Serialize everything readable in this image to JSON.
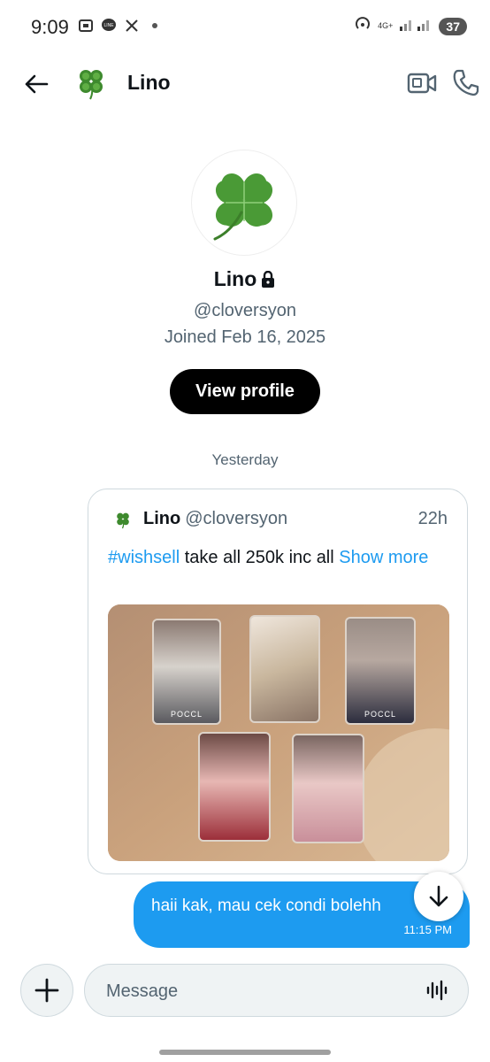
{
  "status_bar": {
    "time": "9:09",
    "network_label": "4G+",
    "battery": "37",
    "left_icons": [
      "screenshot-icon",
      "line-app-icon",
      "x-app-icon",
      "dot-icon"
    ]
  },
  "header": {
    "title": "Lino",
    "icons": [
      "back-arrow-icon",
      "clover-icon",
      "video-call-icon",
      "phone-icon"
    ]
  },
  "profile": {
    "name": "Lino",
    "handle": "@cloversyon",
    "joined": "Joined Feb 16, 2025",
    "view_profile_label": "View profile",
    "locked_icon": "lock-icon"
  },
  "conversation": {
    "date_separator": "Yesterday",
    "shared_post": {
      "author": "Lino",
      "handle": "@cloversyon",
      "time": "22h",
      "hashtag": "#wishsell",
      "text": " take all 250k inc all ",
      "show_more": "Show more",
      "photocard_labels": [
        "POCCL",
        "POCCL"
      ]
    },
    "message": {
      "text": "haii kak, mau cek condi bolehh",
      "time": "11:15 PM"
    }
  },
  "composer": {
    "placeholder": "Message",
    "icons": [
      "plus-icon",
      "voice-wave-icon"
    ]
  },
  "colors": {
    "accent": "#1d9bf0",
    "bubble": "#1d9bf0",
    "button_dark": "#000000",
    "secondary_text": "#536471"
  }
}
